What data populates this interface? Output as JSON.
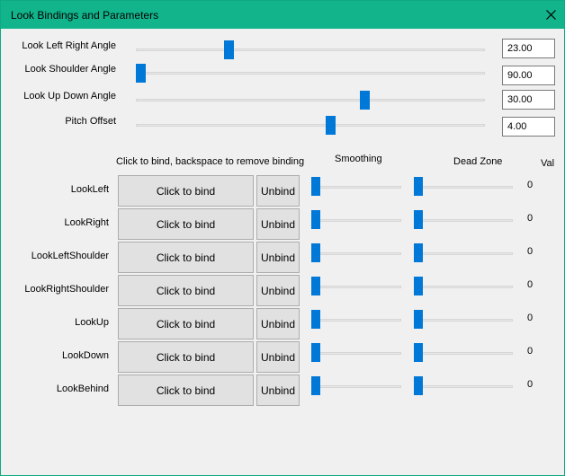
{
  "window": {
    "title": "Look Bindings and Parameters"
  },
  "params": [
    {
      "label": "Look Left Right Angle",
      "value": "23.00",
      "slider": 0.26
    },
    {
      "label": "Look Shoulder Angle",
      "value": "90.00",
      "slider": 0.0
    },
    {
      "label": "Look Up Down Angle",
      "value": "30.00",
      "slider": 0.66
    },
    {
      "label": "Pitch Offset",
      "value": "4.00",
      "slider": 0.56
    }
  ],
  "headers": {
    "bind": "Click to bind, backspace to remove binding",
    "smoothing": "Smoothing",
    "deadzone": "Dead Zone",
    "val": "Val"
  },
  "bindings": [
    {
      "label": "LookLeft",
      "bind": "Click to bind",
      "unbind": "Unbind",
      "val": "0"
    },
    {
      "label": "LookRight",
      "bind": "Click to bind",
      "unbind": "Unbind",
      "val": "0"
    },
    {
      "label": "LookLeftShoulder",
      "bind": "Click to bind",
      "unbind": "Unbind",
      "val": "0"
    },
    {
      "label": "LookRightShoulder",
      "bind": "Click to bind",
      "unbind": "Unbind",
      "val": "0"
    },
    {
      "label": "LookUp",
      "bind": "Click to bind",
      "unbind": "Unbind",
      "val": "0"
    },
    {
      "label": "LookDown",
      "bind": "Click to bind",
      "unbind": "Unbind",
      "val": "0"
    },
    {
      "label": "LookBehind",
      "bind": "Click to bind",
      "unbind": "Unbind",
      "val": "0"
    }
  ],
  "colors": {
    "titlebar": "#11b48b",
    "accent": "#0078d7"
  },
  "icons": {
    "close": "close-icon"
  }
}
